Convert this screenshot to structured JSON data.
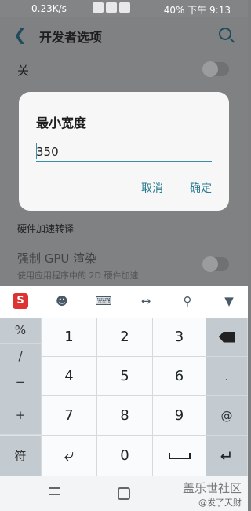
{
  "status": {
    "net": "0.23K/s",
    "battery": "40%",
    "time": "下午 9:13"
  },
  "page": {
    "title": "开发者选项",
    "row_off": "关",
    "section": "硬件加速转译",
    "gpu_title": "强制 GPU 渲染",
    "gpu_sub": "使用应用程序中的 2D 硬件加速"
  },
  "dialog": {
    "title": "最小宽度",
    "value": "350",
    "cancel": "取消",
    "ok": "确定"
  },
  "keyboard": {
    "toolbar_icons": [
      "sogou-logo-icon",
      "emoji-icon",
      "keyboard-icon",
      "cursor-move-icon",
      "search-icon",
      "collapse-icon"
    ],
    "left_col": [
      "%",
      "/",
      "−",
      "+"
    ],
    "keys": [
      [
        "1",
        "2",
        "3"
      ],
      [
        "4",
        "5",
        "6"
      ],
      [
        "7",
        "8",
        "9"
      ]
    ],
    "right_col": [
      ".",
      "@"
    ],
    "bottom": {
      "symbol": "符",
      "zero": "0"
    }
  },
  "watermark": {
    "line1": "盖乐世社区",
    "line2": "@发了天财"
  }
}
